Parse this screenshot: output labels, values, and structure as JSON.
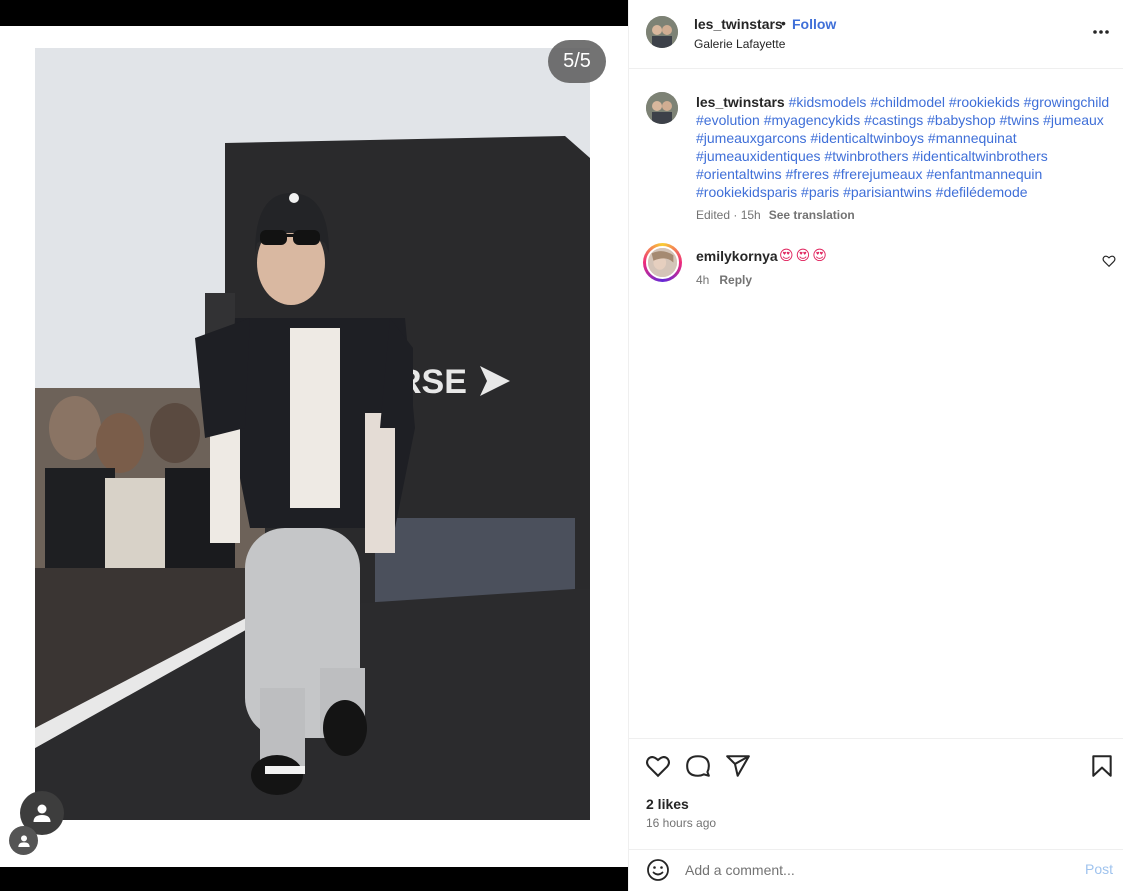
{
  "media": {
    "counter": "5/5",
    "backdrop_logo_text": "RSE"
  },
  "header": {
    "username": "les_twinstars",
    "separator": "•",
    "follow_label": "Follow",
    "location": "Galerie Lafayette"
  },
  "caption": {
    "username": "les_twinstars",
    "hashtags": "#kidsmodels #childmodel #rookiekids #growingchild #evolution #myagencykids #castings #babyshop #twins #jumeaux #jumeauxgarcons #identicaltwinboys #mannequinat #jumeauxidentiques #twinbrothers #identicaltwinbrothers #orientaltwins #freres #frerejumeaux #enfantmannequin #rookiekidsparis #paris #parisiantwins #defilédemode",
    "meta": "Edited · 15h",
    "see_translation": "See translation"
  },
  "comment": {
    "username": "emilykornya",
    "text": "😍😍😍",
    "time": "4h",
    "reply_label": "Reply"
  },
  "footer": {
    "likes": "2 likes",
    "time_ago": "16 hours ago",
    "comment_placeholder": "Add a comment...",
    "post_label": "Post"
  },
  "colors": {
    "link": "#3f6fd8",
    "muted": "#737373",
    "text": "#262626"
  },
  "icons": [
    "more-options-icon",
    "heart-icon",
    "comment-icon",
    "share-icon",
    "bookmark-icon",
    "emoji-icon",
    "user-tag-icon"
  ]
}
